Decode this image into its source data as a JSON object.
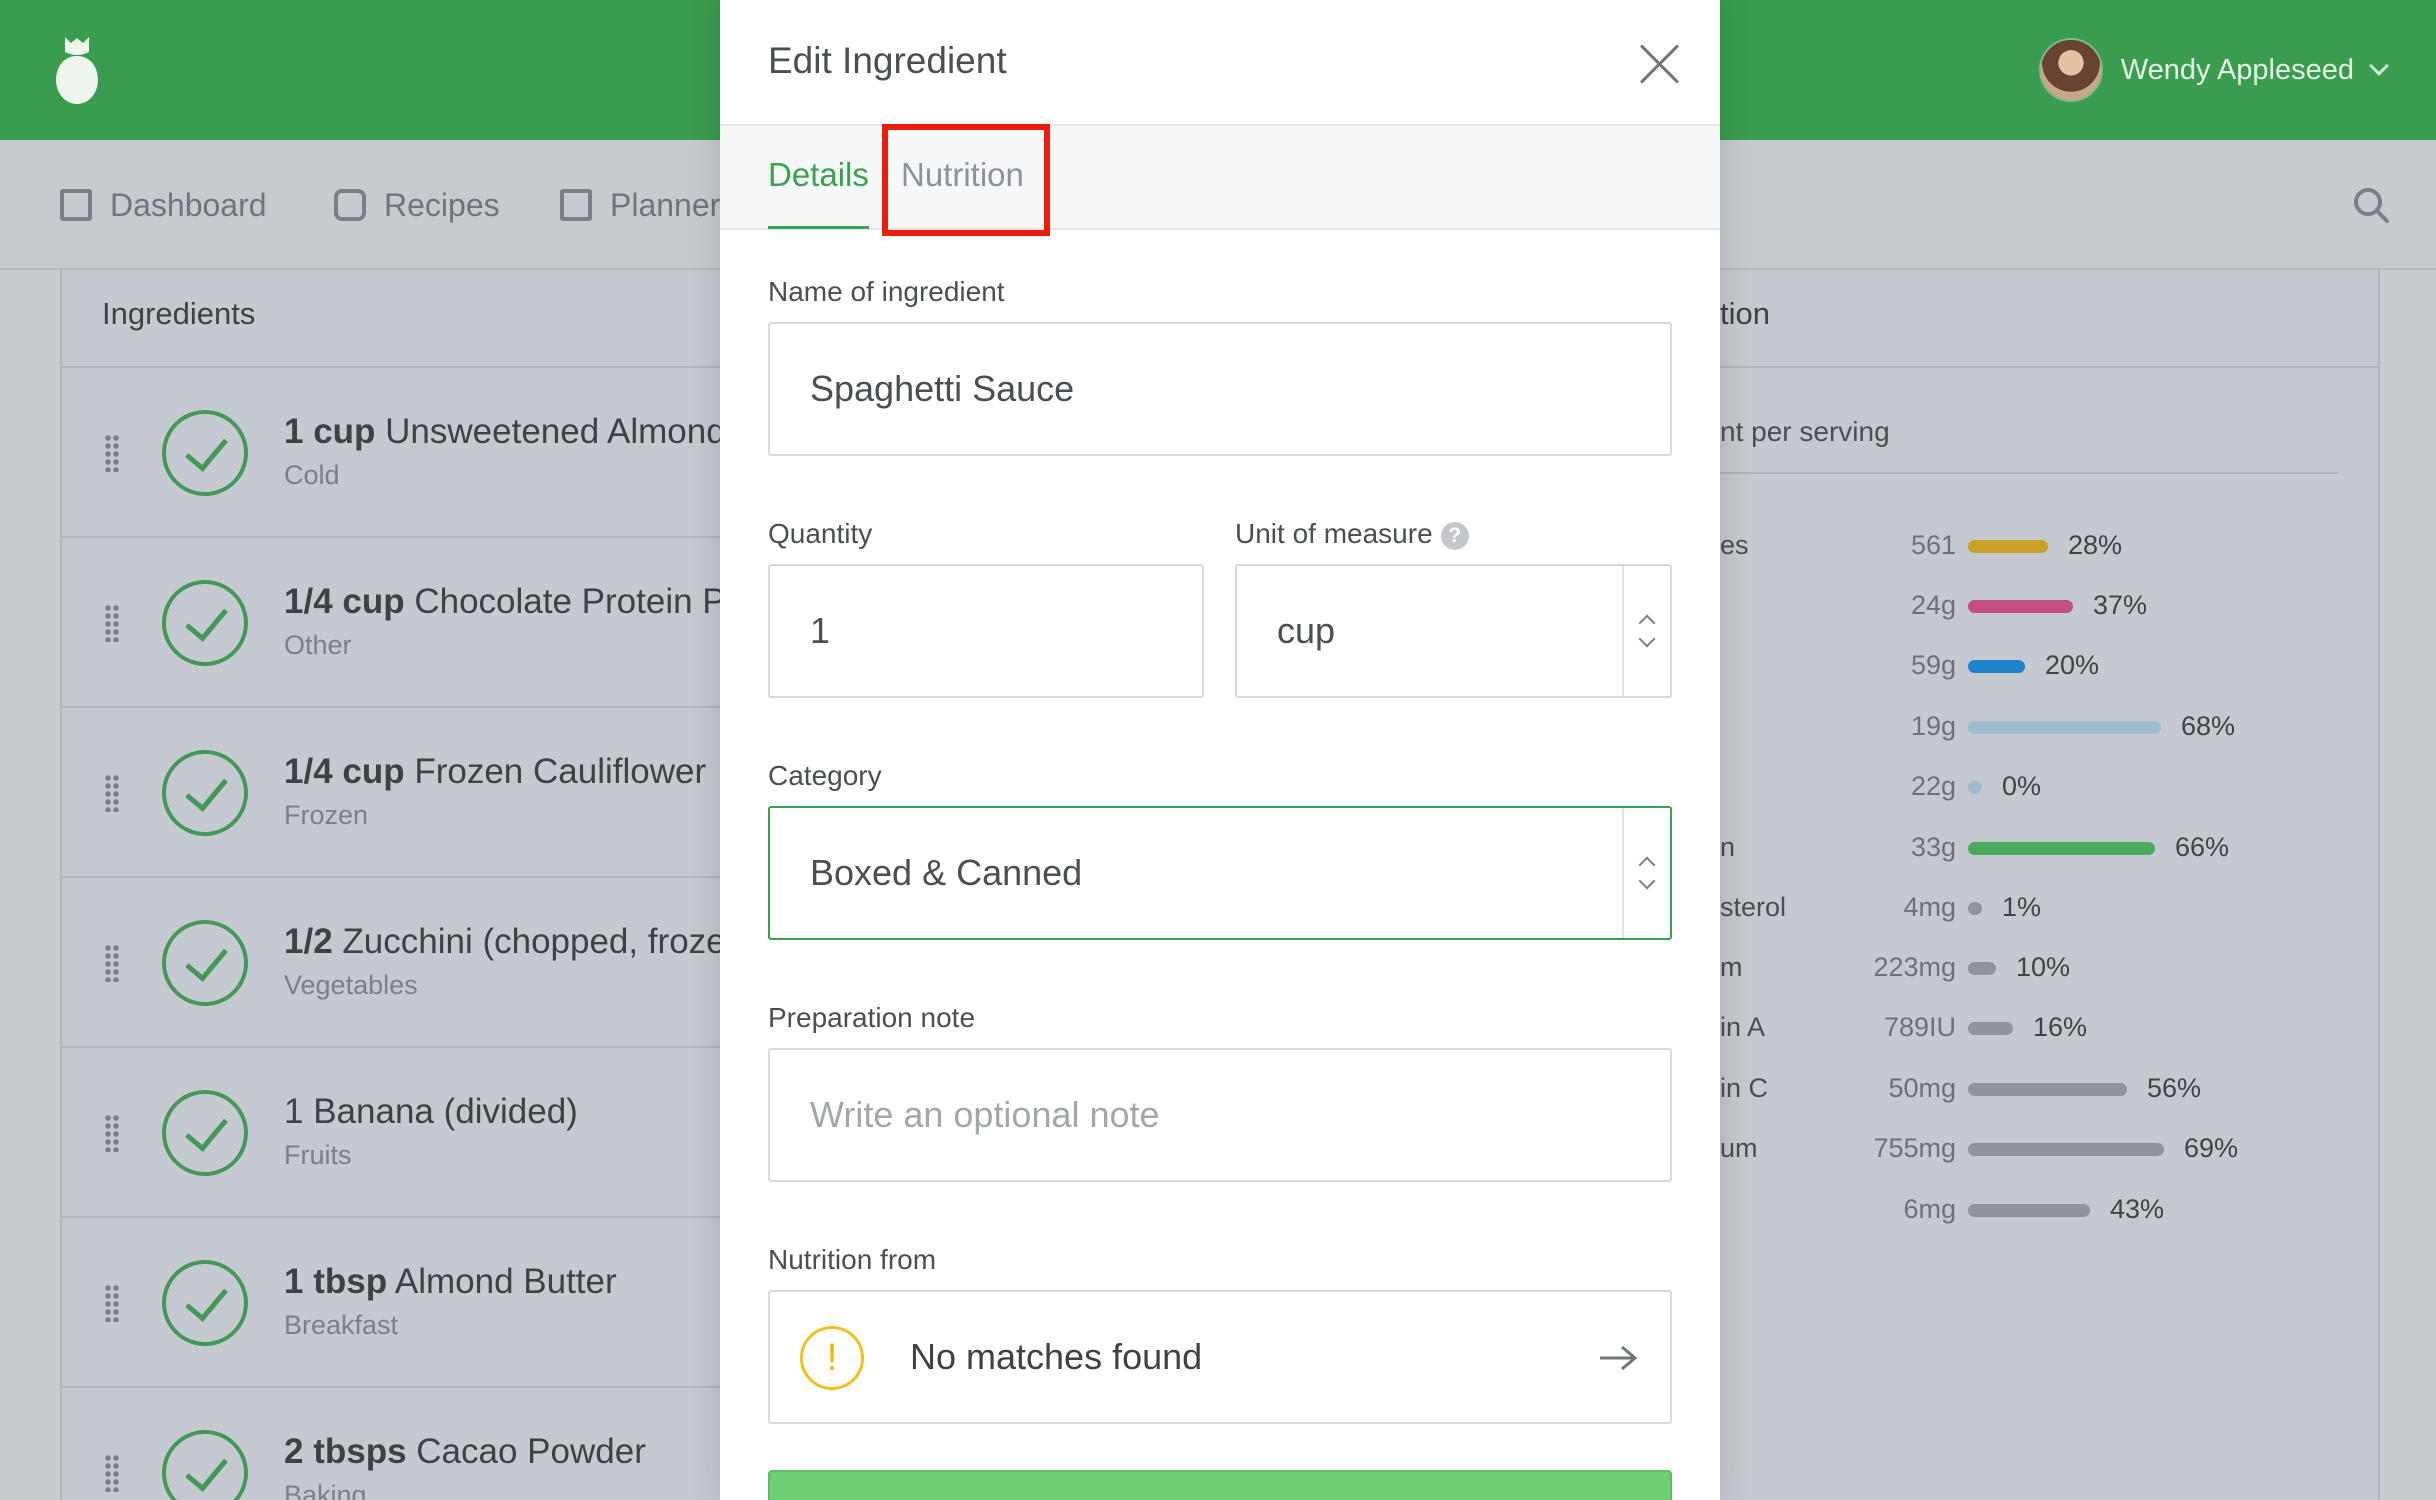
{
  "header": {
    "user_name": "Wendy Appleseed",
    "brand_color": "#3a9c4e"
  },
  "nav": {
    "items": [
      {
        "label": "Dashboard",
        "icon": "dashboard-icon"
      },
      {
        "label": "Recipes",
        "icon": "recipes-icon"
      },
      {
        "label": "Planner",
        "icon": "calendar-icon"
      }
    ]
  },
  "ingredients_panel": {
    "title": "Ingredients",
    "items": [
      {
        "qty": "1 cup",
        "name": "Unsweetened Almond Milk",
        "category": "Cold"
      },
      {
        "qty": "1/4 cup",
        "name": "Chocolate Protein Powder",
        "category": "Other"
      },
      {
        "qty": "1/4 cup",
        "name": "Frozen Cauliflower",
        "category": "Frozen"
      },
      {
        "qty": "1/2",
        "name": "Zucchini (chopped, frozen)",
        "category": "Vegetables"
      },
      {
        "qty": "1",
        "name": "Banana (divided)",
        "category": "Fruits"
      },
      {
        "qty": "1 tbsp",
        "name": "Almond Butter",
        "category": "Breakfast"
      },
      {
        "qty": "2 tbsps",
        "name": "Cacao Powder",
        "category": "Baking"
      }
    ]
  },
  "nutrition_panel": {
    "title": "tion",
    "subtitle": "nt per serving",
    "rows": [
      {
        "name": "es",
        "value": "561",
        "pct": "28%",
        "level": 0.28,
        "color": "#c9a227"
      },
      {
        "name": "",
        "value": "24g",
        "pct": "37%",
        "level": 0.37,
        "color": "#c24f7d"
      },
      {
        "name": "",
        "value": "59g",
        "pct": "20%",
        "level": 0.2,
        "color": "#1f83c9"
      },
      {
        "name": "",
        "value": "19g",
        "pct": "68%",
        "level": 0.68,
        "color": "#9fbccd"
      },
      {
        "name": "",
        "value": "22g",
        "pct": "0%",
        "level": 0.0,
        "color": "#9fbccd"
      },
      {
        "name": "n",
        "value": "33g",
        "pct": "66%",
        "level": 0.66,
        "color": "#4aa95d"
      },
      {
        "name": "sterol",
        "value": "4mg",
        "pct": "1%",
        "level": 0.01,
        "color": "#8f959b"
      },
      {
        "name": "m",
        "value": "223mg",
        "pct": "10%",
        "level": 0.1,
        "color": "#8f959b"
      },
      {
        "name": "in A",
        "value": "789IU",
        "pct": "16%",
        "level": 0.16,
        "color": "#8f959b"
      },
      {
        "name": "in C",
        "value": "50mg",
        "pct": "56%",
        "level": 0.56,
        "color": "#8f959b"
      },
      {
        "name": "um",
        "value": "755mg",
        "pct": "69%",
        "level": 0.69,
        "color": "#8f959b"
      },
      {
        "name": "",
        "value": "6mg",
        "pct": "43%",
        "level": 0.43,
        "color": "#8f959b"
      }
    ]
  },
  "modal": {
    "title": "Edit Ingredient",
    "tabs": {
      "details": "Details",
      "nutrition": "Nutrition"
    },
    "name_label": "Name of ingredient",
    "name_value": "Spaghetti Sauce",
    "quantity_label": "Quantity",
    "quantity_value": "1",
    "unit_label": "Unit of measure",
    "unit_value": "cup",
    "help_glyph": "?",
    "category_label": "Category",
    "category_value": "Boxed & Canned",
    "note_label": "Preparation note",
    "note_placeholder": "Write an optional note",
    "nutrition_from_label": "Nutrition from",
    "nutrition_from_value": "No matches found",
    "warn_glyph": "!",
    "accent": "#3aa24e",
    "highlight_color": "#ee1c0e"
  }
}
